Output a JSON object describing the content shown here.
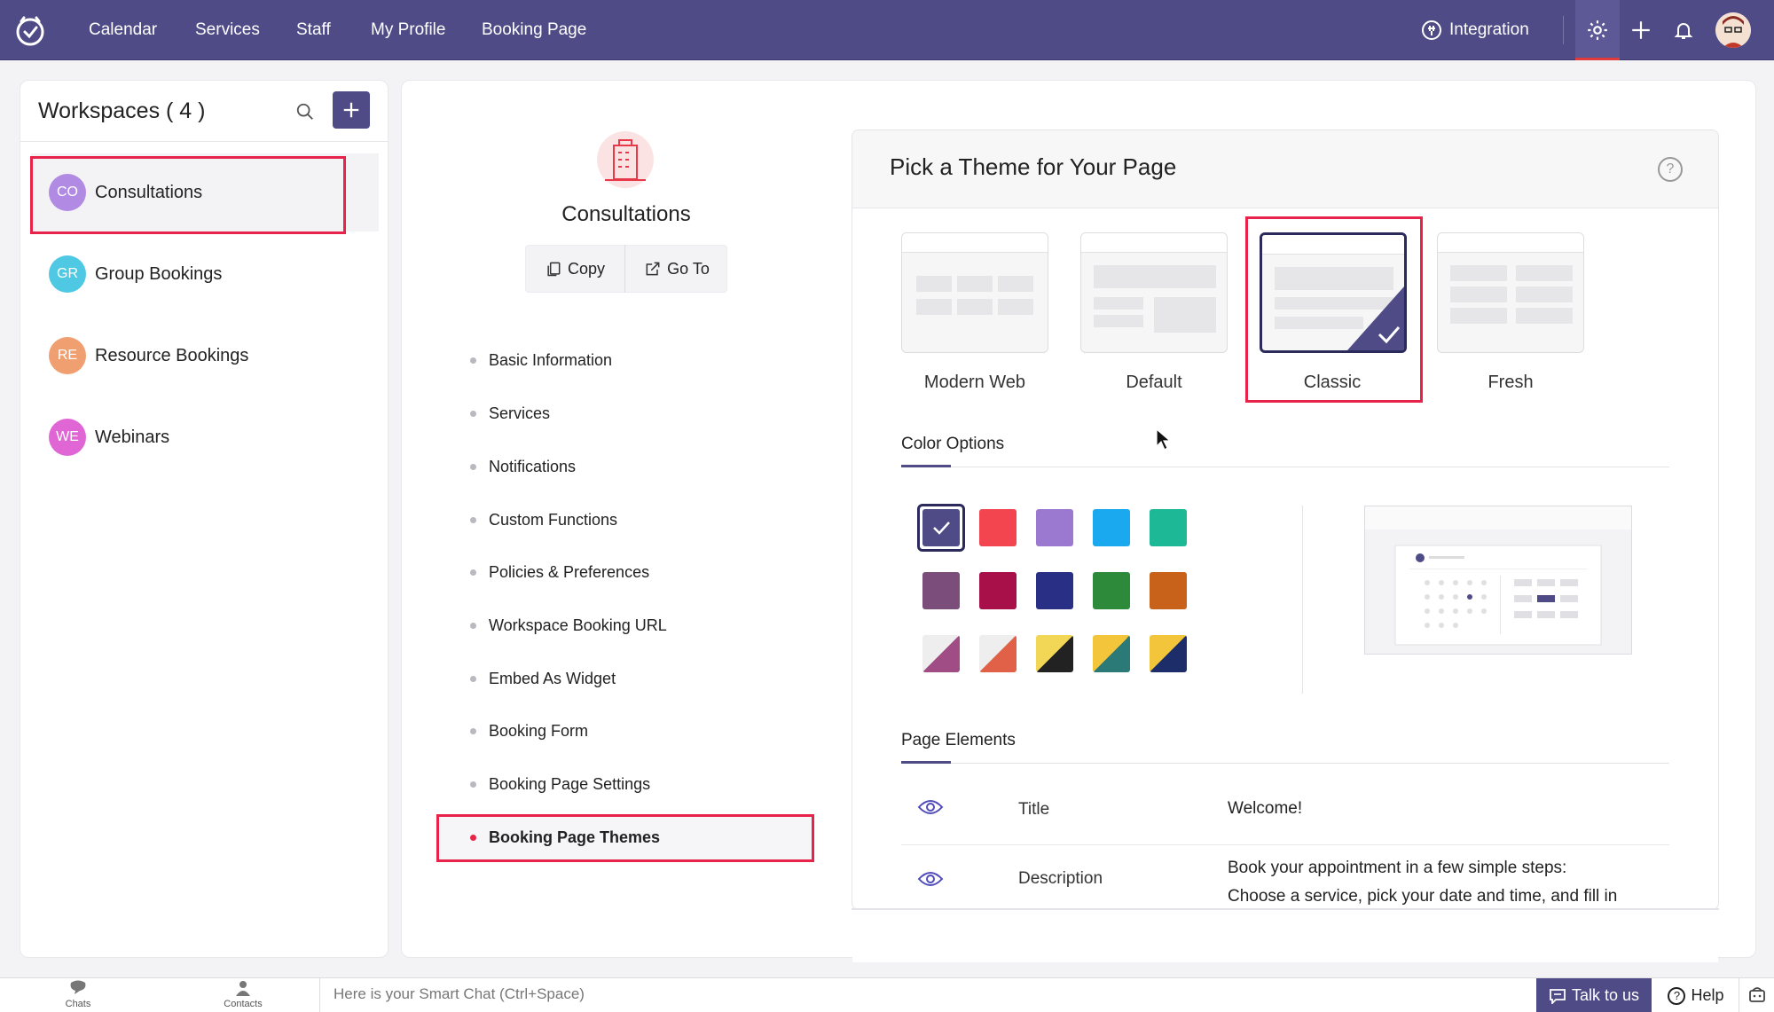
{
  "topbar": {
    "nav": [
      "Calendar",
      "Services",
      "Staff",
      "My Profile",
      "Booking Page"
    ],
    "integration_label": "Integration"
  },
  "workspaces": {
    "title": "Workspaces ( 4 )",
    "items": [
      {
        "initials": "CO",
        "label": "Consultations",
        "color": "#b18be3"
      },
      {
        "initials": "GR",
        "label": "Group Bookings",
        "color": "#4fc9e3"
      },
      {
        "initials": "RE",
        "label": "Resource Bookings",
        "color": "#f0a070"
      },
      {
        "initials": "WE",
        "label": "Webinars",
        "color": "#e066d6"
      }
    ]
  },
  "workspace_detail": {
    "name": "Consultations",
    "copy_label": "Copy",
    "goto_label": "Go To",
    "menu": [
      "Basic Information",
      "Services",
      "Notifications",
      "Custom Functions",
      "Policies & Preferences",
      "Workspace Booking URL",
      "Embed As Widget",
      "Booking Form",
      "Booking Page Settings",
      "Booking Page Themes"
    ],
    "active_menu": "Booking Page Themes"
  },
  "themes": {
    "title": "Pick a Theme for Your Page",
    "options": [
      "Modern Web",
      "Default",
      "Classic",
      "Fresh"
    ],
    "selected": "Classic",
    "color_options_label": "Color Options",
    "selected_color": "#4f4b86",
    "colors_row1": [
      "#4f4b86",
      "#f2454f",
      "#9b79d1",
      "#1aa9ef",
      "#1db996"
    ],
    "colors_row2": [
      "#7a4d7a",
      "#a8104a",
      "#2a2f86",
      "#2d8a3a",
      "#c8621a"
    ],
    "colors_row3": [
      {
        "a": "#eeeeee",
        "b": "#a04d86"
      },
      {
        "a": "#eeeeee",
        "b": "#e06048"
      },
      {
        "a": "#f2d756",
        "b": "#222222"
      },
      {
        "a": "#f2c53a",
        "b": "#2b7a78"
      },
      {
        "a": "#f2c53a",
        "b": "#1d2d6a"
      }
    ],
    "page_elements_label": "Page Elements",
    "elements": [
      {
        "name": "Title",
        "value": "Welcome!"
      },
      {
        "name": "Description",
        "value_line1": "Book your appointment in a few simple steps:",
        "value_line2": "Choose a service, pick your date and time, and fill in"
      }
    ]
  },
  "bottombar": {
    "chats": "Chats",
    "contacts": "Contacts",
    "smart_chat_placeholder": "Here is your Smart Chat (Ctrl+Space)",
    "talk": "Talk to us",
    "help": "Help"
  }
}
